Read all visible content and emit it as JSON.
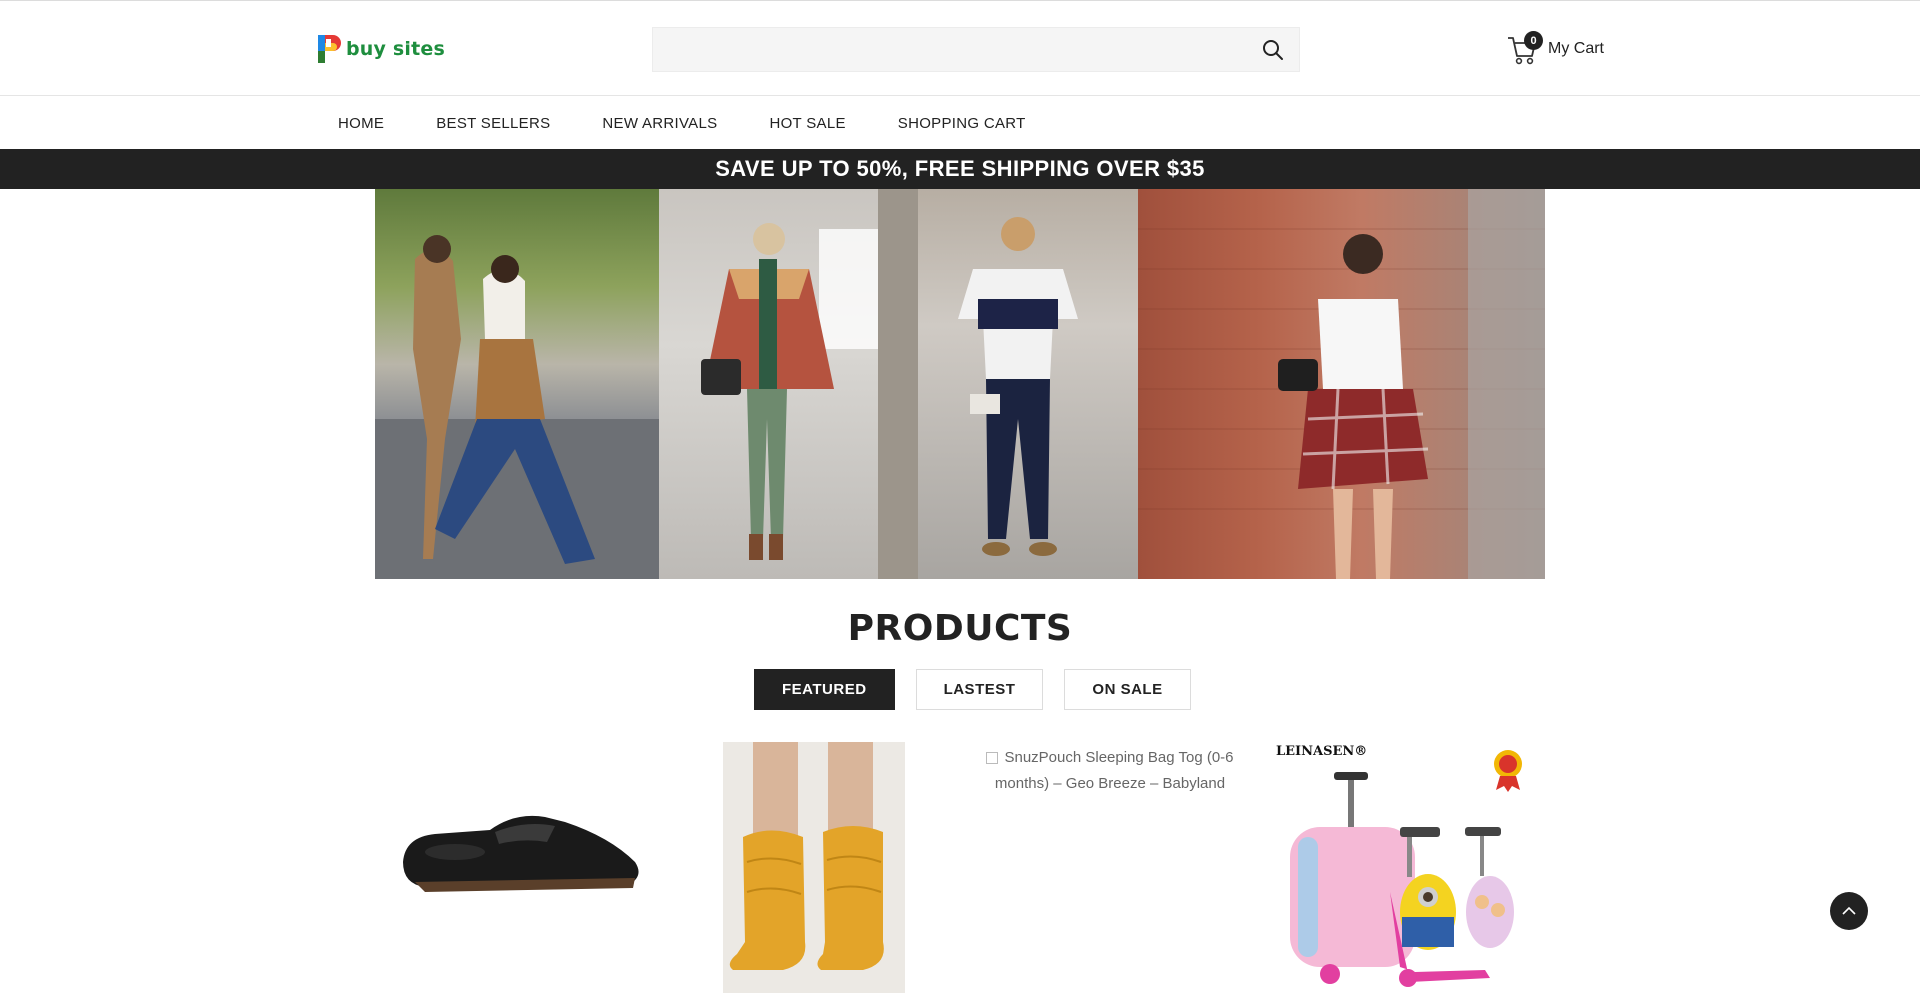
{
  "header": {
    "logo_text": "buy sites",
    "search": {
      "placeholder": "",
      "value": ""
    },
    "cart": {
      "count": "0",
      "label": "My Cart"
    }
  },
  "nav": {
    "items": [
      {
        "label": "HOME"
      },
      {
        "label": "BEST SELLERS"
      },
      {
        "label": "NEW ARRIVALS"
      },
      {
        "label": "HOT SALE"
      },
      {
        "label": "SHOPPING CART"
      }
    ]
  },
  "promo": {
    "text": "SAVE UP TO 50%, FREE SHIPPING OVER $35"
  },
  "products": {
    "title": "PRODUCTS",
    "tabs": [
      {
        "label": "FEATURED",
        "active": true
      },
      {
        "label": "LASTEST",
        "active": false
      },
      {
        "label": "ON SALE",
        "active": false
      }
    ],
    "cards": [
      {
        "image": "black-loafer"
      },
      {
        "image": "yellow-suede-boots"
      },
      {
        "image_alt": "SnuzPouch Sleeping Bag Tog (0-6 months) – Geo Breeze – Babyland"
      },
      {
        "brand": "LEINASEN®",
        "image": "kids-scooter-suitcase"
      }
    ]
  },
  "colors": {
    "dark": "#222222",
    "logo_green": "#1e8e3e",
    "search_bg": "#f5f5f5"
  }
}
